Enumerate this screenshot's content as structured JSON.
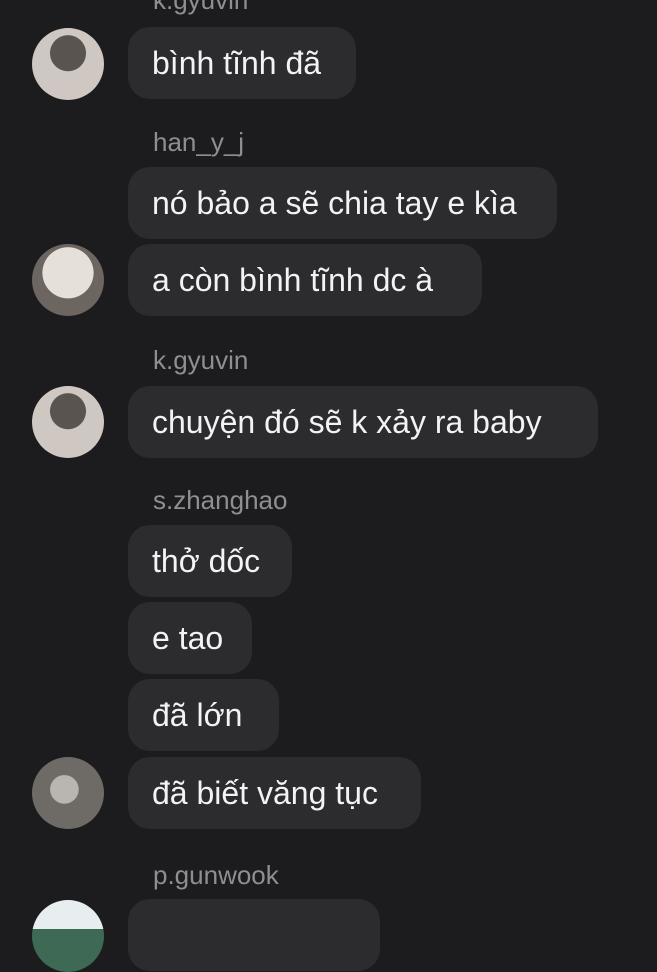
{
  "messages": [
    {
      "sender": "k.gyuvin",
      "lines": [
        "bình tĩnh đã"
      ],
      "avatar": "avatar-white-mask"
    },
    {
      "sender": "han_y_j",
      "lines": [
        "nó bảo a sẽ chia tay e kìa",
        "a còn bình tĩnh dc à"
      ],
      "avatar": "avatar-black-mask"
    },
    {
      "sender": "k.gyuvin",
      "lines": [
        "chuyện đó sẽ k xảy ra baby"
      ],
      "avatar": "avatar-white-mask"
    },
    {
      "sender": "s.zhanghao",
      "lines": [
        "thở dốc",
        "e tao",
        "đã lớn",
        "đã biết văng tục"
      ],
      "avatar": "avatar-gray-photo"
    },
    {
      "sender": "p.gunwook",
      "lines": [],
      "avatar": "avatar-outdoor"
    }
  ],
  "colors": {
    "background": "#1c1c1e",
    "bubble": "#2c2c2e",
    "text": "#f2f2f7",
    "sender": "#8e8e93"
  }
}
